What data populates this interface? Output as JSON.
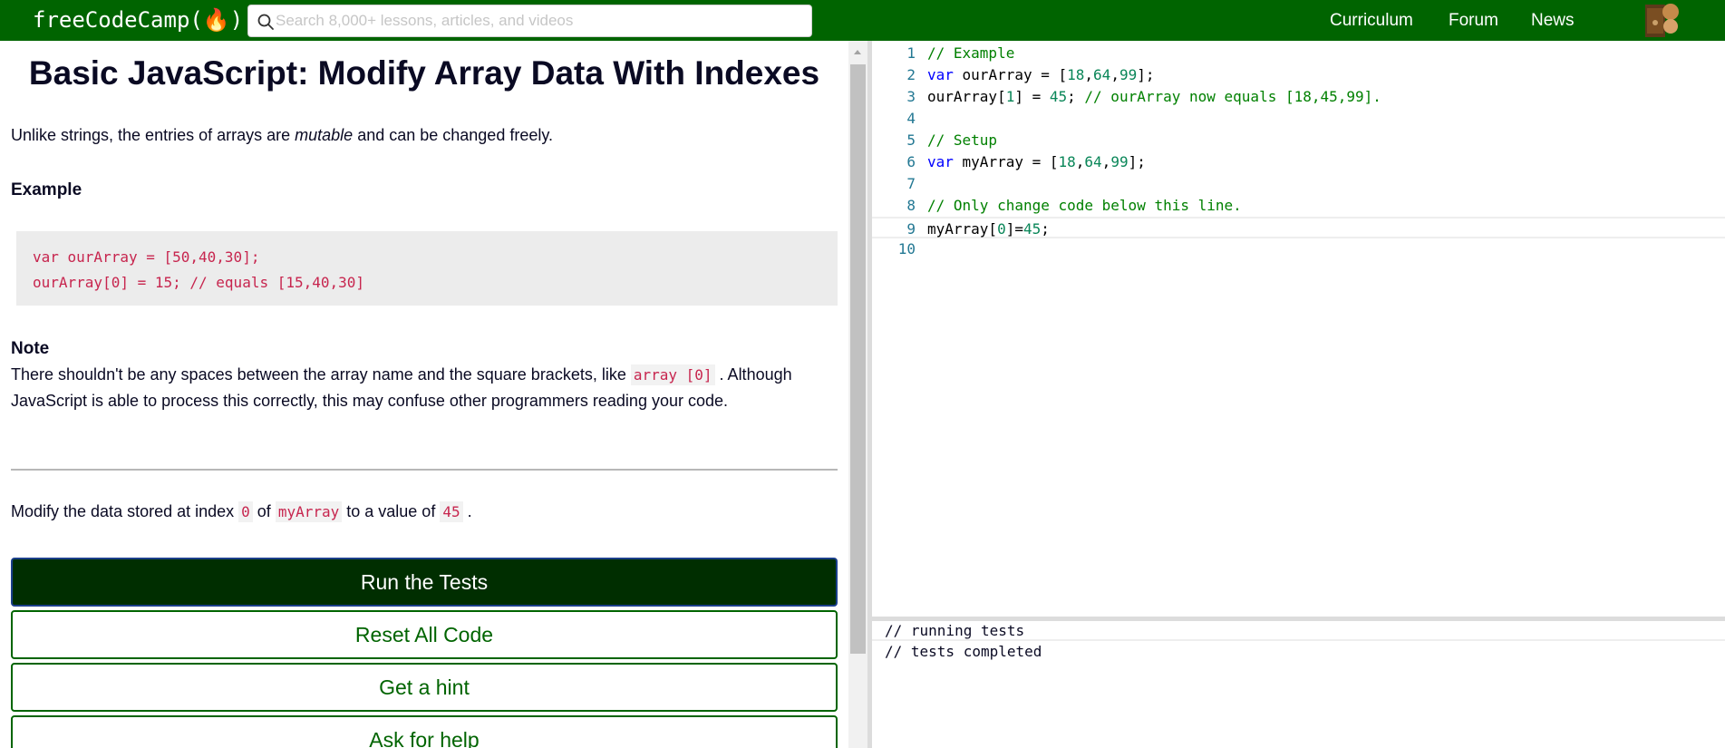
{
  "navbar": {
    "brand": "freeCodeCamp(🔥)",
    "search_placeholder": "Search 8,000+ lessons, articles, and videos",
    "links": [
      "Curriculum",
      "Forum",
      "News"
    ]
  },
  "challenge": {
    "title": "Basic JavaScript: Modify Array Data With Indexes",
    "intro_before": "Unlike strings, the entries of arrays are ",
    "intro_em": "mutable",
    "intro_after": " and can be changed freely.",
    "example_heading": "Example",
    "example_code": [
      "var ourArray = [50,40,30];",
      "ourArray[0] = 15; // equals [15,40,30]"
    ],
    "note_heading": "Note",
    "note_before": "There shouldn't be any spaces between the array name and the square brackets, like ",
    "note_code": "array [0]",
    "note_after": " . Although JavaScript is able to process this correctly, this may confuse other programmers reading your code.",
    "task_1": "Modify the data stored at index ",
    "task_code_1": "0",
    "task_2": " of ",
    "task_code_2": "myArray",
    "task_3": " to a value of ",
    "task_code_3": "45",
    "task_4": " ."
  },
  "buttons": {
    "run": "Run the Tests",
    "reset": "Reset All Code",
    "hint": "Get a hint",
    "help": "Ask for help"
  },
  "editor": {
    "lines": [
      {
        "n": "1",
        "t": "// Example"
      },
      {
        "n": "2",
        "t": "var ourArray = [18,64,99];"
      },
      {
        "n": "3",
        "t": "ourArray[1] = 45; // ourArray now equals [18,45,99]."
      },
      {
        "n": "4",
        "t": ""
      },
      {
        "n": "5",
        "t": "// Setup"
      },
      {
        "n": "6",
        "t": "var myArray = [18,64,99];"
      },
      {
        "n": "7",
        "t": ""
      },
      {
        "n": "8",
        "t": "// Only change code below this line."
      },
      {
        "n": "9",
        "t": "myArray[0]=45;"
      },
      {
        "n": "10",
        "t": ""
      }
    ]
  },
  "console": {
    "lines": [
      "// running tests",
      "// tests completed"
    ]
  },
  "colors": {
    "nav_bg": "#006400",
    "primary_button": "#002e00",
    "inline_code": "#c7254e",
    "comment": "#008000",
    "keyword": "#0000ff",
    "number": "#098658",
    "line_number": "#237893"
  }
}
